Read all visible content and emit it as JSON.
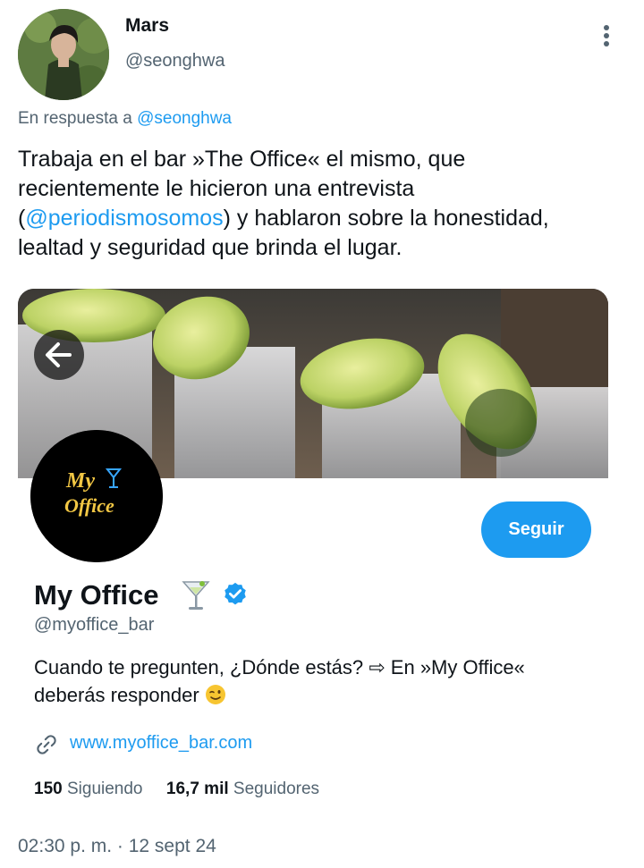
{
  "author": {
    "name": "Mars",
    "handle": "@seonghwa"
  },
  "reply": {
    "prefix": "En respuesta a",
    "mention": "@seonghwa"
  },
  "tweet": {
    "line1": "Trabaja en el bar »The Office« el mismo, que",
    "line2": "recientemente le hicieron una entrevista",
    "paren_open": "(",
    "mention": "@periodismosomos",
    "line3_rest": ") y hablaron sobre la honestidad,",
    "line4": "lealtad y seguridad que brinda el lugar."
  },
  "card": {
    "logo_text_1": "My",
    "logo_text_2": "Office",
    "follow_label": "Seguir",
    "name": "My Office",
    "handle": "@myoffice_bar",
    "bio_line1": "Cuando te pregunten, ¿Dónde estás? ⇨ En »My Office«",
    "bio_line2": "deberás responder",
    "link": "www.myoffice_bar.com",
    "following_count": "150",
    "following_label": "Siguiendo",
    "followers_count": "16,7 mil",
    "followers_label": "Seguidores"
  },
  "timestamp": "02:30 p. m. · 12 sept 24",
  "icons": {
    "more": "more-vertical-icon",
    "back": "arrow-left-icon",
    "verified": "verified-badge-icon",
    "link": "link-icon",
    "cocktail": "cocktail-emoji",
    "wink": "wink-emoji"
  },
  "colors": {
    "accent": "#1d9bf0",
    "secondary_text": "#536471",
    "primary_text": "#0f1419"
  }
}
